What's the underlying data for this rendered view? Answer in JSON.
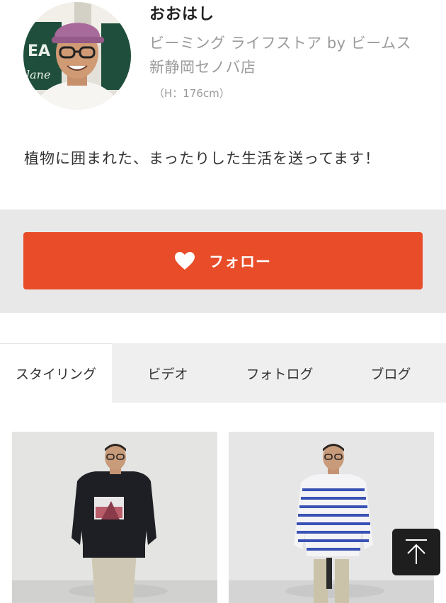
{
  "profile": {
    "name": "おおはし",
    "shop": "ビーミング ライフストア by ビームス 新静岡セノバ店",
    "height": "（H：176cm）",
    "bio": "植物に囲まれた、まったりした生活を送ってます！"
  },
  "follow": {
    "label": "フォロー",
    "color": "#e84c28"
  },
  "tabs": [
    {
      "label": "スタイリング",
      "active": true
    },
    {
      "label": "ビデオ",
      "active": false
    },
    {
      "label": "フォトログ",
      "active": false
    },
    {
      "label": "ブログ",
      "active": false
    }
  ],
  "icons": {
    "follow": "heart-icon",
    "scroll": "arrow-up-icon"
  }
}
